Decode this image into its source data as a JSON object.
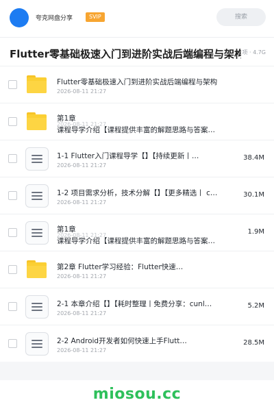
{
  "header": {
    "brand": "夸克网盘分享",
    "badge": "SVIP",
    "search_placeholder": "搜索"
  },
  "folder_title": "Flutter零基础极速入门到进阶实战后端编程与架构",
  "folder_meta": "项 · 4.7G",
  "items": [
    {
      "type": "folder",
      "name": "Flutter零基础极速入门到进阶实战后端编程与架构",
      "date": "2026-08-11 21:27",
      "size": ""
    },
    {
      "type": "folder",
      "name": "第1章",
      "name_line2": "课程导学介绍【课程提供丰富的解题思路与答案…",
      "date": "2026-08-11 21:27",
      "size": ""
    },
    {
      "type": "file",
      "name": "1-1 Flutter入门课程导学【】【持续更新丨…",
      "date": "2026-08-11 21:27",
      "size": "38.4M"
    },
    {
      "type": "file",
      "name": "1-2 项目需求分析，技术分解【】【更多精选丨 c…",
      "date": "2026-08-11 21:27",
      "size": "30.1M"
    },
    {
      "type": "file",
      "name": "第1章",
      "name_line2": "课程导学介绍【课程提供丰富的解题思路与答案…",
      "date": "2026-08-11 21:27",
      "size": "1.9M"
    },
    {
      "type": "folder",
      "name": "第2章 Flutter学习经验：Flutter快速…",
      "date": "2026-08-11 21:27",
      "size": ""
    },
    {
      "type": "file",
      "name": "2-1 本章介绍【】【耗时整理丨免费分享：cunl…",
      "date": "2026-08-11 21:27",
      "size": "5.2M"
    },
    {
      "type": "file",
      "name": "2-2 Android开发者如何快速上手Flutt…",
      "date": "2026-08-11 21:27",
      "size": "28.5M"
    }
  ],
  "footer": {
    "watermark": "miosou.cc"
  }
}
